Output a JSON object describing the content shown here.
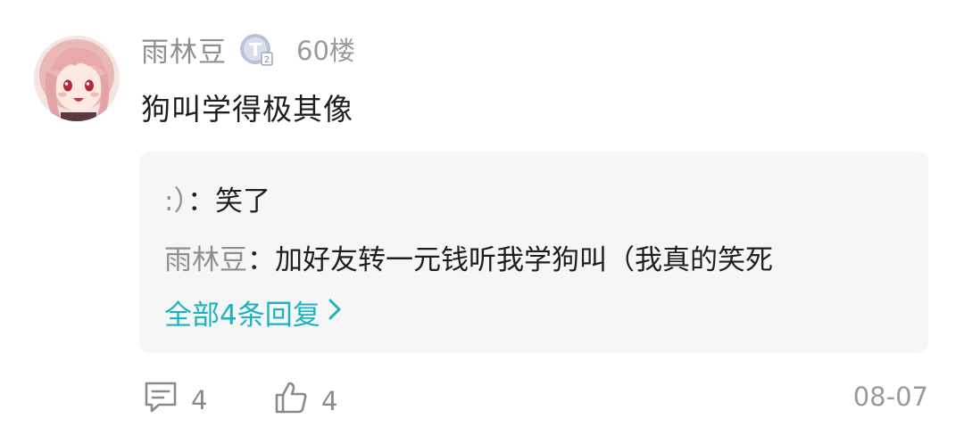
{
  "comment": {
    "username": "雨林豆",
    "level_badge": "T2",
    "floor": "60楼",
    "text": "狗叫学得极其像"
  },
  "replies": [
    {
      "author": ":）",
      "separator": "：",
      "text": "笑了"
    },
    {
      "author": "雨林豆",
      "separator": "：",
      "text": "加好友转一元钱听我学狗叫（我真的笑死"
    }
  ],
  "more_replies_label": "全部4条回复",
  "footer": {
    "comment_count": "4",
    "like_count": "4",
    "date": "08-07"
  },
  "colors": {
    "link": "#1bb3c1",
    "username": "#8f8f8f",
    "reply_bg": "#f6f6f6"
  },
  "icons": {
    "comment": "comment-icon",
    "like": "thumbs-up-icon",
    "chevron": "chevron-right-icon",
    "badge": "level-badge-icon"
  }
}
